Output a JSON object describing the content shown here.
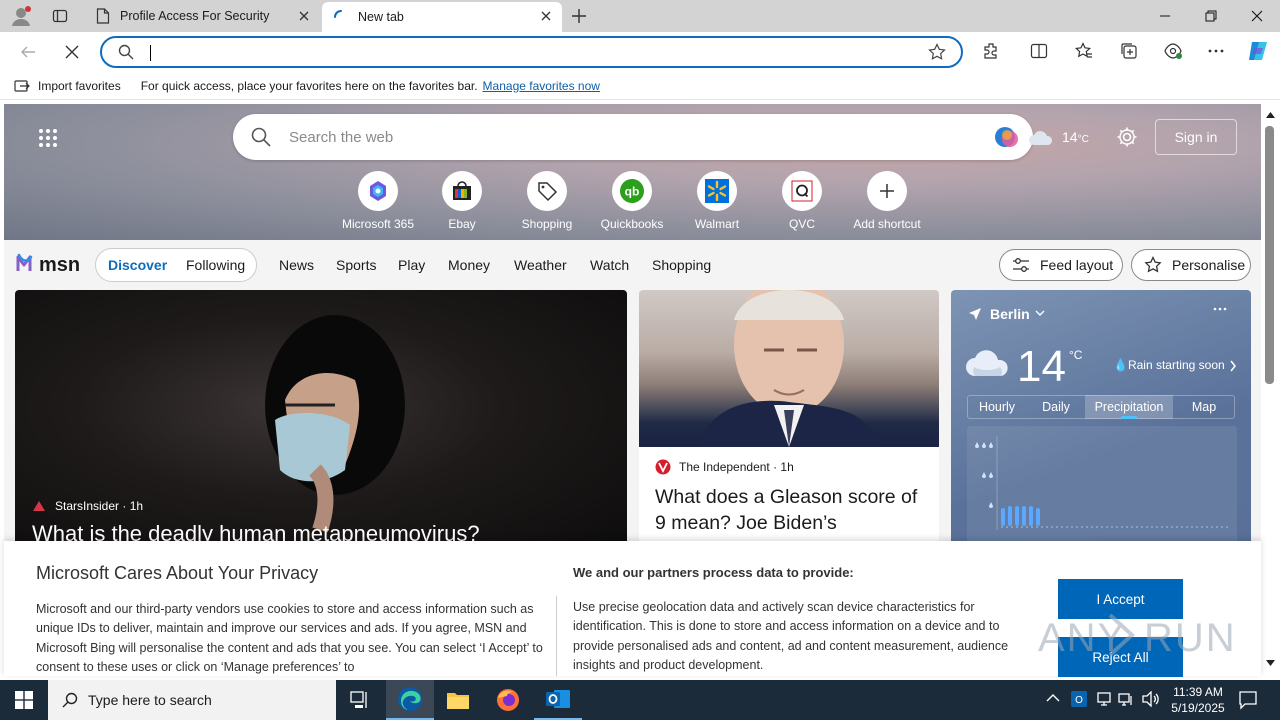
{
  "tabs": [
    {
      "title": "Profile Access For Security"
    },
    {
      "title": "New tab"
    }
  ],
  "address_bar": {
    "value": "",
    "placeholder": ""
  },
  "favorites_bar": {
    "import_label": "Import favorites",
    "hint": "For quick access, place your favorites here on the favorites bar.",
    "manage_link": "Manage favorites now"
  },
  "msn_search": {
    "placeholder": "Search the web"
  },
  "hero_weather": {
    "temp": "14",
    "unit": "°C"
  },
  "sign_in": "Sign in",
  "shortcuts": [
    {
      "label": "Microsoft 365",
      "icon": "microsoft365-icon"
    },
    {
      "label": "Ebay",
      "icon": "ebay-icon"
    },
    {
      "label": "Shopping",
      "icon": "shopping-tag-icon"
    },
    {
      "label": "Quickbooks",
      "icon": "quickbooks-icon"
    },
    {
      "label": "Walmart",
      "icon": "walmart-icon"
    },
    {
      "label": "QVC",
      "icon": "qvc-icon"
    },
    {
      "label": "Add shortcut",
      "icon": "plus-icon"
    }
  ],
  "msn": {
    "logo": "msn",
    "tabs": [
      "Discover",
      "Following"
    ],
    "nav": [
      "News",
      "Sports",
      "Play",
      "Money",
      "Weather",
      "Watch",
      "Shopping"
    ],
    "feed_layout": "Feed layout",
    "personalise": "Personalise"
  },
  "cards": {
    "card1": {
      "source": "StarsInsider",
      "time": "1h",
      "headline": "What is the deadly human metapneumovirus?"
    },
    "card2": {
      "source": "The Independent",
      "time": "1h",
      "headline": "What does a Gleason score of 9 mean? Joe Biden’s"
    }
  },
  "weather": {
    "city": "Berlin",
    "temp": "14",
    "unit": "°C",
    "alert": "Rain starting soon",
    "tabs": [
      "Hourly",
      "Daily",
      "Precipitation",
      "Map"
    ],
    "active_tab": "Precipitation"
  },
  "privacy": {
    "title": "Microsoft Cares About Your Privacy",
    "body": "Microsoft and our third-party vendors use cookies to store and access information such as unique IDs to deliver, maintain and improve our services and ads. If you agree, MSN and Microsoft Bing will personalise the content and ads that you see. You can select ‘I Accept’ to consent to these uses or click on ‘Manage preferences’ to",
    "col2_title": "We and our partners process data to provide:",
    "col2_body": "Use precise geolocation data and actively scan device characteristics for identification. This is done to store and access information on a device and to provide personalised ads and content, ad and content measurement, audience insights and product development.",
    "accept": "I Accept",
    "reject": "Reject All"
  },
  "watermark": "ANY RUN",
  "taskbar": {
    "search_placeholder": "Type here to search",
    "time": "11:39 AM",
    "date": "5/19/2025"
  }
}
